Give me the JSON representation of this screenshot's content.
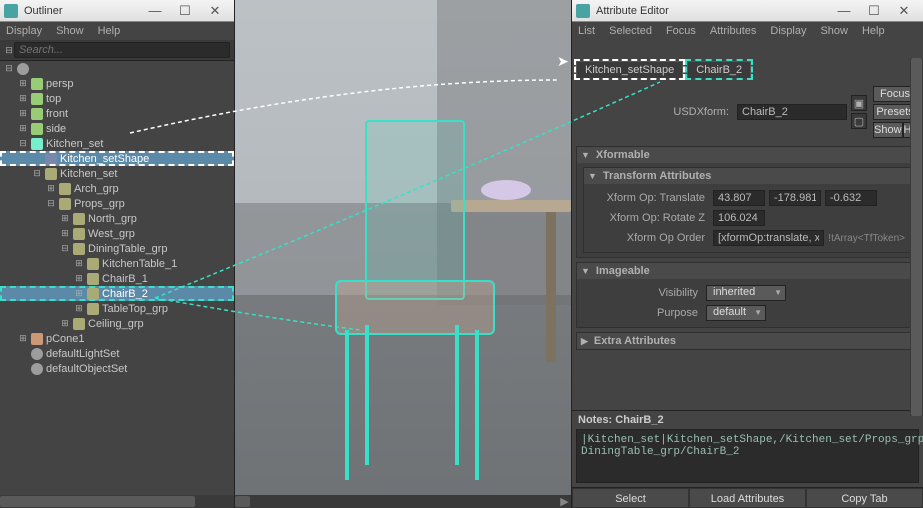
{
  "outliner": {
    "title": "Outliner",
    "menus": [
      "Display",
      "Show",
      "Help"
    ],
    "search_placeholder": "Search...",
    "tree": [
      {
        "indent": 0,
        "toggle": "⊟",
        "icon": "obj",
        "label": ""
      },
      {
        "indent": 1,
        "toggle": "⊞",
        "icon": "cam",
        "label": "persp"
      },
      {
        "indent": 1,
        "toggle": "⊞",
        "icon": "cam",
        "label": "top"
      },
      {
        "indent": 1,
        "toggle": "⊞",
        "icon": "cam",
        "label": "front"
      },
      {
        "indent": 1,
        "toggle": "⊞",
        "icon": "cam",
        "label": "side"
      },
      {
        "indent": 1,
        "toggle": "⊟",
        "icon": "usd",
        "label": "Kitchen_set",
        "sel": false
      },
      {
        "indent": 2,
        "toggle": "",
        "icon": "mesh",
        "label": "Kitchen_setShape",
        "sel": true,
        "hlW": true
      },
      {
        "indent": 2,
        "toggle": "⊟",
        "icon": "xform",
        "label": "Kitchen_set"
      },
      {
        "indent": 3,
        "toggle": "⊞",
        "icon": "xform",
        "label": "Arch_grp"
      },
      {
        "indent": 3,
        "toggle": "⊟",
        "icon": "xform",
        "label": "Props_grp"
      },
      {
        "indent": 4,
        "toggle": "⊞",
        "icon": "xform",
        "label": "North_grp"
      },
      {
        "indent": 4,
        "toggle": "⊞",
        "icon": "xform",
        "label": "West_grp"
      },
      {
        "indent": 4,
        "toggle": "⊟",
        "icon": "xform",
        "label": "DiningTable_grp"
      },
      {
        "indent": 5,
        "toggle": "⊞",
        "icon": "xform",
        "label": "KitchenTable_1"
      },
      {
        "indent": 5,
        "toggle": "⊞",
        "icon": "xform",
        "label": "ChairB_1"
      },
      {
        "indent": 5,
        "toggle": "⊞",
        "icon": "xform",
        "label": "ChairB_2",
        "sel": true,
        "hlC": true
      },
      {
        "indent": 5,
        "toggle": "⊞",
        "icon": "xform",
        "label": "TableTop_grp"
      },
      {
        "indent": 4,
        "toggle": "⊞",
        "icon": "xform",
        "label": "Ceiling_grp"
      },
      {
        "indent": 1,
        "toggle": "⊞",
        "icon": "cone",
        "label": "pCone1"
      },
      {
        "indent": 1,
        "toggle": "",
        "icon": "obj",
        "label": "defaultLightSet"
      },
      {
        "indent": 1,
        "toggle": "",
        "icon": "obj",
        "label": "defaultObjectSet"
      }
    ]
  },
  "attr": {
    "title": "Attribute Editor",
    "menus": [
      "List",
      "Selected",
      "Focus",
      "Attributes",
      "Display",
      "Show",
      "Help"
    ],
    "tabs": [
      {
        "label": "Kitchen_setShape",
        "style": "dashedW"
      },
      {
        "label": "ChairB_2",
        "style": "dashedC"
      }
    ],
    "node": {
      "type_label": "USDXform:",
      "name": "ChairB_2"
    },
    "side_btns": {
      "focus": "Focus",
      "presets": "Presets",
      "show": "Show",
      "hide": "Hide"
    },
    "sections": {
      "xformable": "Xformable",
      "transform": "Transform Attributes",
      "t_translate": {
        "label": "Xform Op: Translate",
        "x": "43.807",
        "y": "-178.981",
        "z": "-0.632"
      },
      "t_rotz": {
        "label": "Xform Op: Rotate Z",
        "v": "106.024"
      },
      "t_order": {
        "label": "Xform Op Order",
        "v": "[xformOp:translate, xformOp:rotateZ]",
        "type": "!tArray<TfToken>"
      },
      "imageable": "Imageable",
      "visibility": {
        "label": "Visibility",
        "v": "inherited"
      },
      "purpose": {
        "label": "Purpose",
        "v": "default"
      },
      "extra": "Extra Attributes"
    },
    "notes": {
      "header": "Notes: ChairB_2",
      "text": "|Kitchen_set|Kitchen_setShape,/Kitchen_set/Props_grp/\nDiningTable_grp/ChairB_2"
    },
    "bottom": {
      "select": "Select",
      "load": "Load Attributes",
      "copy": "Copy Tab"
    }
  },
  "winctl": {
    "min": "—",
    "max": "☐",
    "close": "✕"
  }
}
